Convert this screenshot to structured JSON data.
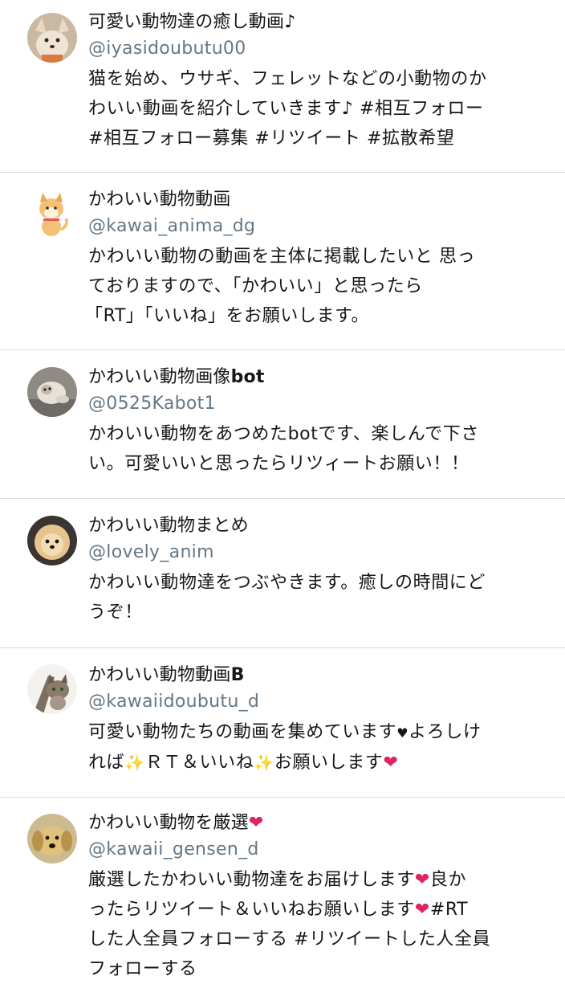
{
  "accounts": [
    {
      "name": "可愛い動物達の癒し動画♪",
      "handle": "@iyasidoubutu00",
      "bio": [
        "猫を始め、ウサギ、フェレットなどの小動物のか",
        "わいい動画を紹介していきます♪ #相互フォロー",
        "#相互フォロー募集 #リツイート #拡散希望"
      ],
      "avatar": "fennec-fox-avatar"
    },
    {
      "name": "かわいい動物動画",
      "handle": "@kawai_anima_dg",
      "bio": [
        "かわいい動物の動画を主体に掲載したいと 思っ",
        "ておりますので、「かわいい」と思ったら",
        "「RT」「いいね」をお願いします。"
      ],
      "avatar": "shiba-dog-illustration-avatar"
    },
    {
      "name_text": "かわいい動物画像",
      "name_suffix": "bot",
      "handle": "@0525Kabot1",
      "bio": [
        "かわいい動物をあつめたbotです、楽しんで下さ",
        "い。可愛いいと思ったらリツィートお願い！！"
      ],
      "avatar": "kitten-avatar"
    },
    {
      "name": "かわいい動物まとめ",
      "handle": "@lovely_anim",
      "bio": [
        "かわいい動物達をつぶやきます。癒しの時間にど",
        "うぞ！"
      ],
      "avatar": "pomeranian-avatar"
    },
    {
      "name_text": "かわいい動物動画",
      "name_suffix": "B",
      "handle": "@kawaiidoubutu_d",
      "bio_line1_a": "可愛い動物たちの動画を集めています",
      "bio_line1_b": "よろしけ",
      "bio_line2_a": "れば",
      "bio_line2_b": "ＲＴ＆いいね",
      "bio_line2_c": "お願いします",
      "avatar": "tabby-kitten-avatar"
    },
    {
      "name": "かわいい動物を厳選",
      "handle": "@kawaii_gensen_d",
      "bio_line1_a": "厳選したかわいい動物達をお届けします",
      "bio_line1_b": "良か",
      "bio_line2_a": "ったらリツイート＆いいねお願いします",
      "bio_line2_b": "#RT",
      "bio_line3": "した人全員フォローする #リツイートした人全員",
      "bio_line4": "フォローする",
      "avatar": "golden-retriever-puppy-avatar"
    }
  ],
  "glyphs": {
    "heart": "❤",
    "small_heart": "♥",
    "sparkles": "✨"
  },
  "colors": {
    "handle": "#657786",
    "divider": "#d9dde1",
    "heart": "#e0245e"
  }
}
